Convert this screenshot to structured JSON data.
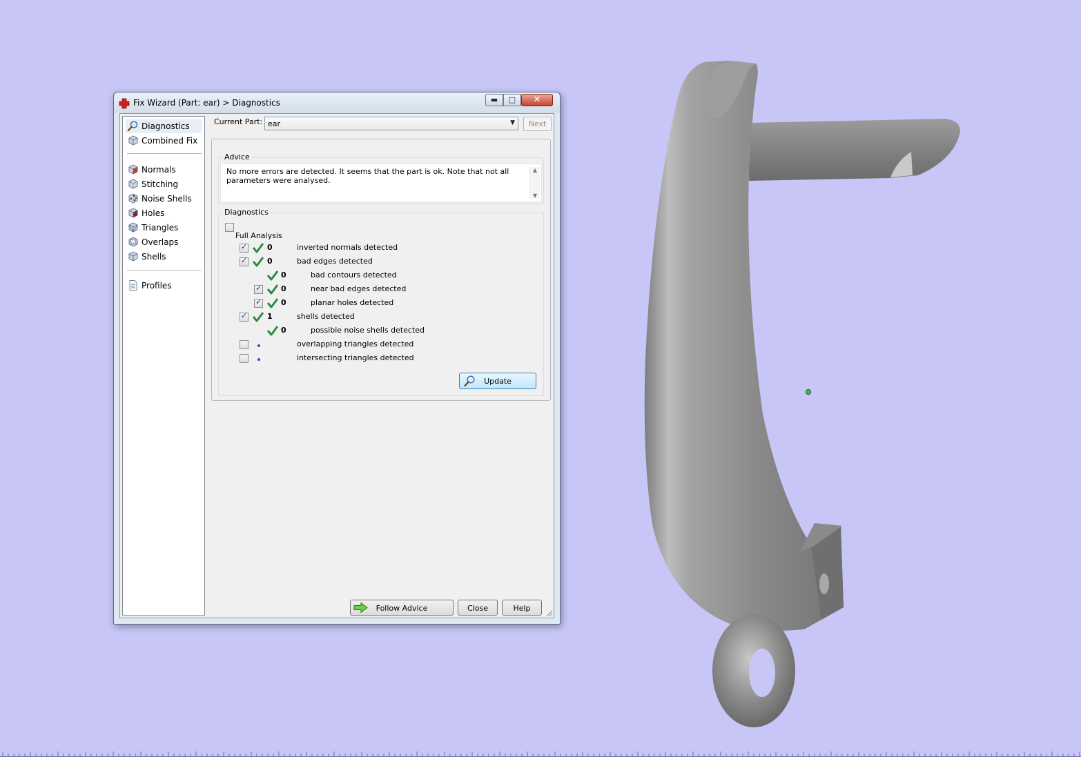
{
  "dialog": {
    "title": "Fix Wizard (Part: ear) > Diagnostics",
    "window_controls": {
      "minimize_icon": "minimize-icon",
      "maximize_icon": "maximize-icon",
      "close_icon": "close-icon"
    }
  },
  "nav": {
    "items": [
      {
        "label": "Diagnostics",
        "icon": "magnifier-icon",
        "active": true
      },
      {
        "label": "Combined Fix",
        "icon": "cube-icon"
      },
      {
        "label": "Normals",
        "icon": "normals-cube-icon"
      },
      {
        "label": "Stitching",
        "icon": "stitching-cube-icon"
      },
      {
        "label": "Noise Shells",
        "icon": "noise-shells-icon"
      },
      {
        "label": "Holes",
        "icon": "holes-cube-icon"
      },
      {
        "label": "Triangles",
        "icon": "triangles-cube-icon"
      },
      {
        "label": "Overlaps",
        "icon": "overlaps-cube-icon"
      },
      {
        "label": "Shells",
        "icon": "shells-cube-icon"
      },
      {
        "label": "Profiles",
        "icon": "document-icon"
      }
    ]
  },
  "current_part": {
    "label": "Current Part:",
    "value": "ear",
    "next_label": "Next"
  },
  "advice": {
    "title": "Advice",
    "text": "No more errors are detected. It seems that the part is ok. Note that not all parameters were analysed."
  },
  "diagnostics": {
    "title": "Diagnostics",
    "full_analysis_label": "Full Analysis",
    "full_analysis_checked": false,
    "rows": [
      {
        "checked": true,
        "status": "ok",
        "count": "0",
        "label": "inverted normals detected",
        "indent": 0,
        "has_checkbox": true
      },
      {
        "checked": true,
        "status": "ok",
        "count": "0",
        "label": "bad edges detected",
        "indent": 0,
        "has_checkbox": true
      },
      {
        "checked": false,
        "status": "ok",
        "count": "0",
        "label": "bad contours detected",
        "indent": 1,
        "has_checkbox": false
      },
      {
        "checked": true,
        "status": "ok",
        "count": "0",
        "label": "near bad edges detected",
        "indent": 1,
        "has_checkbox": true
      },
      {
        "checked": true,
        "status": "ok",
        "count": "0",
        "label": "planar holes detected",
        "indent": 1,
        "has_checkbox": true
      },
      {
        "checked": true,
        "status": "ok",
        "count": "1",
        "label": "shells detected",
        "indent": 0,
        "has_checkbox": true
      },
      {
        "checked": false,
        "status": "ok",
        "count": "0",
        "label": "possible noise shells detected",
        "indent": 1,
        "has_checkbox": false
      },
      {
        "checked": false,
        "status": "pending",
        "count": "",
        "label": "overlapping triangles detected",
        "indent": 0,
        "has_checkbox": true
      },
      {
        "checked": false,
        "status": "pending",
        "count": "",
        "label": "intersecting triangles detected",
        "indent": 0,
        "has_checkbox": true
      }
    ],
    "update_label": "Update"
  },
  "footer": {
    "follow_advice_label": "Follow Advice",
    "close_label": "Close",
    "help_label": "Help"
  },
  "colors": {
    "viewport_background": "#c7c6f7",
    "model_gray": "#8e8e8e",
    "ok_check": "#2e8b3d",
    "pivot_marker": "#3cbf4a"
  }
}
